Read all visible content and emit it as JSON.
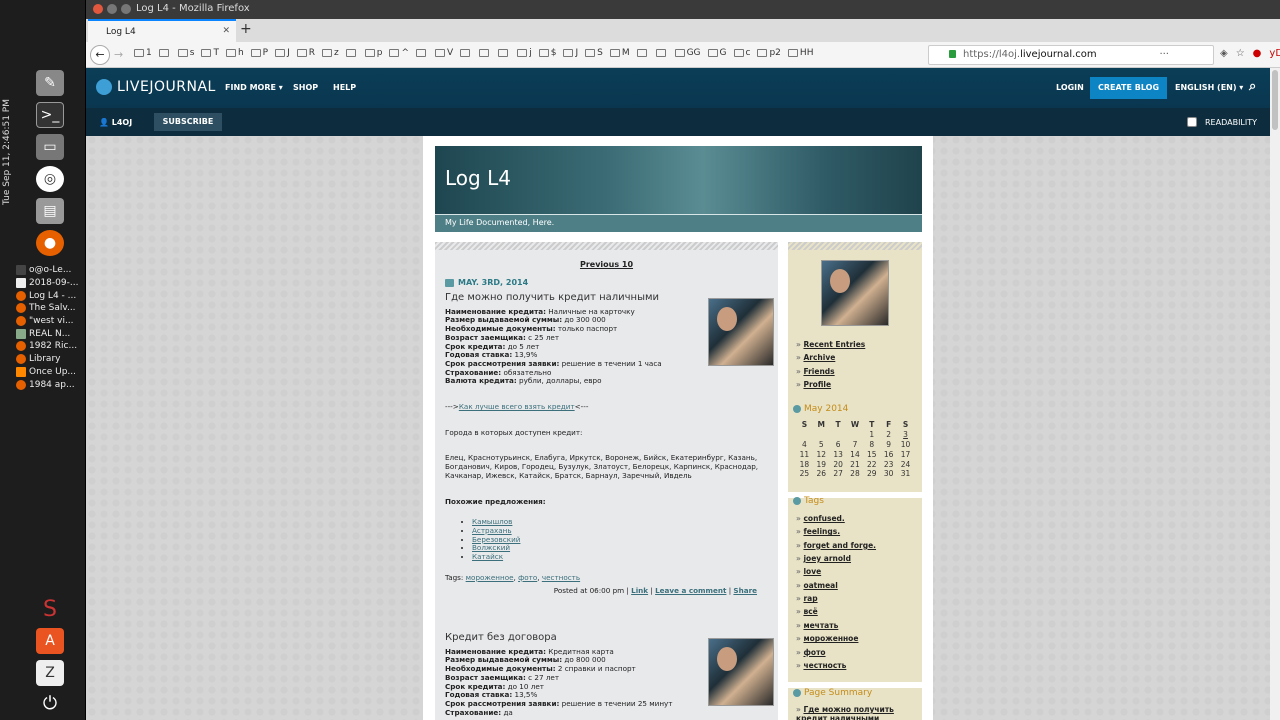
{
  "os": {
    "clock": "Tue Sep 11, 2:46:51 PM",
    "tasks": [
      "o@o-Le...",
      "2018-09-...",
      "Log L4 - ...",
      "The Salv...",
      "\"west vi...",
      "REAL N...",
      "1982 Ric...",
      "Library",
      "Once Up...",
      "1984 ap..."
    ]
  },
  "browser": {
    "window_title": "Log L4 - Mozilla Firefox",
    "tab_title": "Log L4",
    "url_prefix": "https://l4oj.",
    "url_domain": "livejournal.com",
    "bookmarks": [
      "1",
      "",
      "s",
      "T",
      "h",
      "P",
      "J",
      "R",
      "z",
      "",
      "p",
      "^",
      "",
      "V",
      "",
      "",
      "",
      "j",
      "$",
      "J",
      "S",
      "M",
      "",
      "",
      "GG",
      "G",
      "c",
      "p2",
      "HH"
    ]
  },
  "lj": {
    "logo": "LIVEJOURNAL",
    "find_more": "FIND MORE",
    "shop": "SHOP",
    "help": "HELP",
    "login": "LOGIN",
    "create_blog": "CREATE BLOG",
    "language": "ENGLISH (EN)",
    "username": "L4OJ",
    "subscribe": "SUBSCRIBE",
    "readability": "READABILITY"
  },
  "blog": {
    "title": "Log L4",
    "subtitle": "My Life Documented, Here.",
    "previous": "Previous 10",
    "date": "MAY. 3RD, 2014",
    "posts": [
      {
        "title": "Где можно получить кредит наличными",
        "fields": [
          [
            "Наименование кредита:",
            " Наличные на карточку"
          ],
          [
            "Размер выдаваемой суммы:",
            " до 300 000"
          ],
          [
            "Необходимые документы:",
            " только паспорт"
          ],
          [
            "Возраст заемщика:",
            " с 25 лет"
          ],
          [
            "Срок кредита:",
            " до 5 лет"
          ],
          [
            "Годовая ставка:",
            " 13,9%"
          ],
          [
            "Срок рассмотрения заявки:",
            " решение в течении 1 часа"
          ],
          [
            "Страхование:",
            " обязательно"
          ],
          [
            "Валюта кредита:",
            " рубли, доллары, евро"
          ]
        ],
        "arrow_pre": "--->",
        "arrow_link": "Как лучше всего взять кредит",
        "arrow_post": "<---",
        "cities_label": "Города в которых доступен кредит:",
        "cities": "Елец, Краснотурьинск, Елабуга, Иркутск, Воронеж, Бийск, Екатеринбург, Казань, Богданович, Киров, Городец, Бузулук, Златоуст, Белорецк, Карпинск, Краснодар, Качканар, Ижевск, Катайск, Братск, Барнаул, Заречный, Ивдель",
        "similar_label": "Похожие предложения:",
        "similar": [
          "Камышлов",
          "Астрахань",
          "Березовский",
          "Волжский",
          "Катайск"
        ],
        "tags_label": "Tags: ",
        "tags": [
          "мороженное",
          "фото",
          "честность"
        ],
        "posted": "Posted at 06:00 pm | ",
        "link": "Link",
        "leave": "Leave a comment",
        "share": "Share"
      },
      {
        "title": "Кредит без договора",
        "fields": [
          [
            "Наименование кредита:",
            " Кредитная карта"
          ],
          [
            "Размер выдаваемой суммы:",
            " до 800 000"
          ],
          [
            "Необходимые документы:",
            " 2 справки и паспорт"
          ],
          [
            "Возраст заемщика:",
            " с 27 лет"
          ],
          [
            "Срок кредита:",
            " до 10 лет"
          ],
          [
            "Годовая ставка:",
            " 13,5%"
          ],
          [
            "Срок рассмотрения заявки:",
            " решение в течении 25 минут"
          ],
          [
            "Страхование:",
            " да"
          ]
        ]
      }
    ]
  },
  "sidebar": {
    "links": [
      "Recent Entries",
      "Archive",
      "Friends",
      "Profile"
    ],
    "calendar_title": "May 2014",
    "weekdays": [
      "S",
      "M",
      "T",
      "W",
      "T",
      "F",
      "S"
    ],
    "weeks": [
      [
        "",
        "",
        "",
        "",
        "1",
        "2",
        "3"
      ],
      [
        "4",
        "5",
        "6",
        "7",
        "8",
        "9",
        "10"
      ],
      [
        "11",
        "12",
        "13",
        "14",
        "15",
        "16",
        "17"
      ],
      [
        "18",
        "19",
        "20",
        "21",
        "22",
        "23",
        "24"
      ],
      [
        "25",
        "26",
        "27",
        "28",
        "29",
        "30",
        "31"
      ]
    ],
    "tags_title": "Tags",
    "tags": [
      "confused.",
      "feelings.",
      "forget and forge.",
      "joey arnold",
      "love",
      "oatmeal",
      "rap",
      "всё",
      "мечтать",
      "мороженное",
      "фото",
      "честность"
    ],
    "summary_title": "Page Summary",
    "summary_item": "Где можно получить кредит наличными"
  }
}
